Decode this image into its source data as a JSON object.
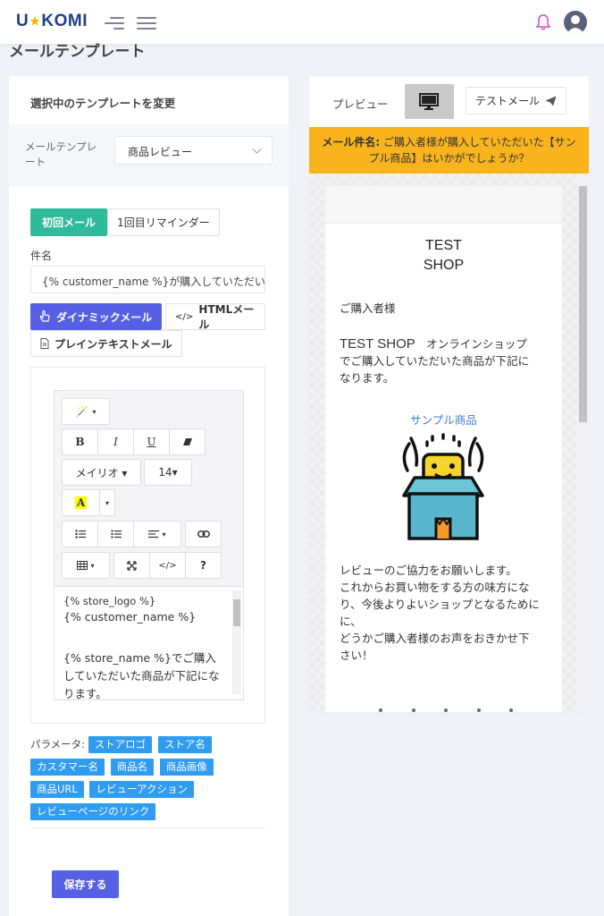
{
  "header": {
    "logo_left": "U",
    "logo_star": "★",
    "logo_right": "KOMI"
  },
  "page_title": "メールテンプレート",
  "left_panel": {
    "heading": "選択中のテンプレートを変更",
    "template_label": "メールテンプレート",
    "template_selected": "商品レビュー",
    "tabs": [
      "初回メール",
      "1回目リマインダー"
    ],
    "subject_label": "件名",
    "subject_value": "{% customer_name %}が購入していただいた",
    "modes": [
      "ダイナミックメール",
      "HTMLメール",
      "プレインテキストメール"
    ],
    "toolbar": {
      "font_name": "メイリオ ▾",
      "font_size": "14▾",
      "bold": "B",
      "italic": "I",
      "underline": "U",
      "code": "</>",
      "help": "?"
    },
    "editor_lines": [
      "{% store_logo %}",
      "{% customer_name %}",
      "",
      "{% store_name %}でご購入",
      "していただいた商品が下記にな",
      "ります。"
    ],
    "params_label": "パラメータ:",
    "params": [
      "ストアロゴ",
      "ストア名",
      "カスタマー名",
      "商品名",
      "商品画像",
      "商品URL",
      "レビューアクション",
      "レビューページのリンク"
    ],
    "save_label": "保存する"
  },
  "right_panel": {
    "preview_label": "プレビュー",
    "test_mail_label": "テストメール",
    "subject_prefix": "メール件名:",
    "subject_text": " ご購入者様が購入していただいた【サンプル商品】はいかがでしょうか？",
    "shop_name_line1": "TEST",
    "shop_name_line2": "SHOP",
    "greeting": "ご購入者様",
    "intro_shop": "TEST SHOP",
    "intro_text1": "　オンラインショップ",
    "intro_text2": "でご購入していただいた商品が下記に",
    "intro_text3": "なります。",
    "product_link": "サンプル商品",
    "body_lines": [
      "レビューのご協力をお願いします。",
      "これからお買い物をする方の味方にな",
      "り、今後よりよいショップとなるために",
      "に、",
      "どうかご購入者様のお声をおきかせ下",
      "さい！"
    ]
  },
  "colors": {
    "primary": "#5560e4",
    "teal": "#2fbb9a",
    "tag_blue": "#2f9cf0",
    "subject_bar": "#f8b31d",
    "logo_blue": "#1f3f8f"
  }
}
